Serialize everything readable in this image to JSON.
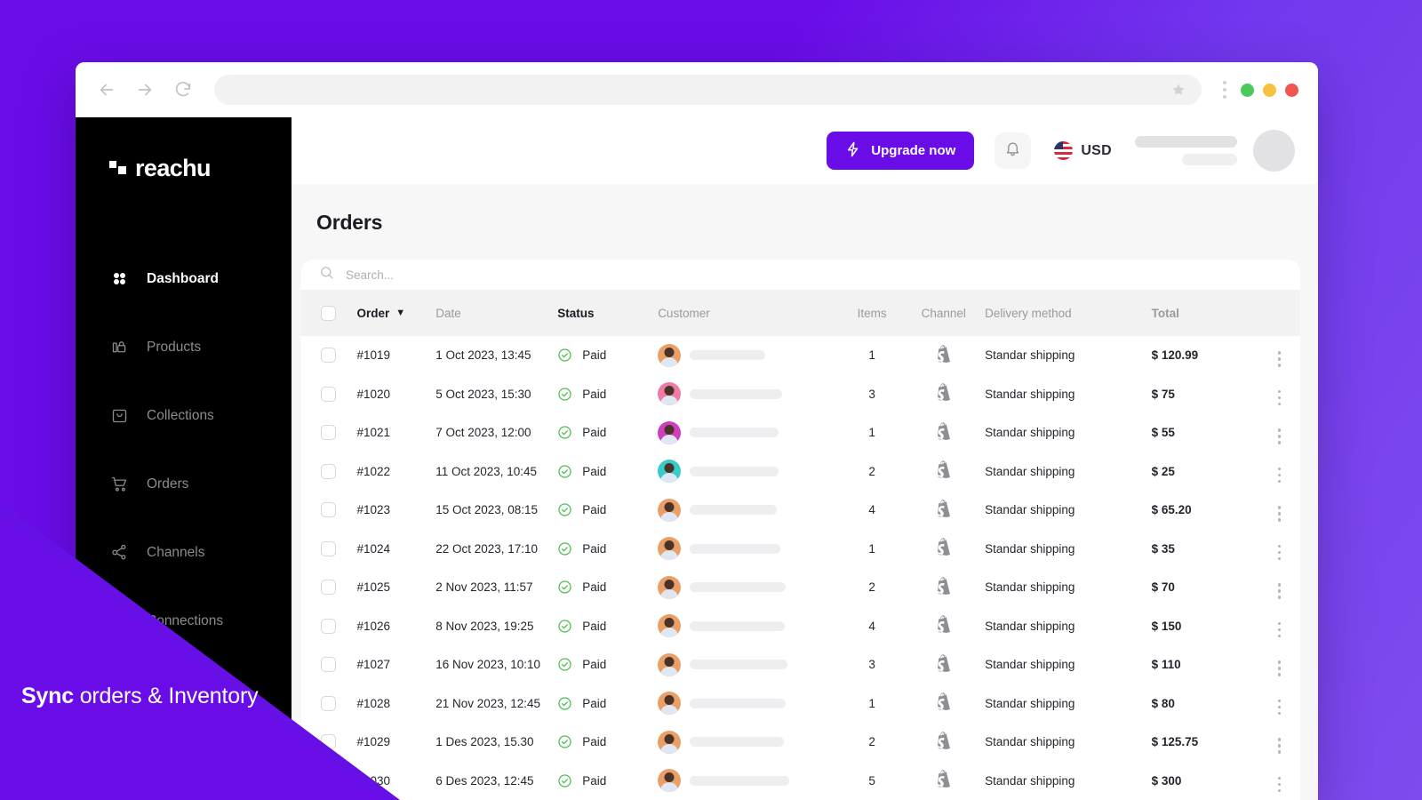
{
  "browser": {
    "back_icon": "arrow-left-icon",
    "forward_icon": "arrow-right-icon",
    "reload_icon": "reload-icon",
    "url_value": "",
    "url_placeholder": "",
    "bookmark_icon": "star-icon",
    "menu_icon": "kebab-menu-icon",
    "window_dots": [
      "#4CC95C",
      "#F7C13E",
      "#F0564F"
    ]
  },
  "sidebar": {
    "logo": "reachu",
    "items": [
      {
        "label": "Dashboard",
        "icon": "grid-icon",
        "active": true
      },
      {
        "label": "Products",
        "icon": "bag-icon",
        "active": false
      },
      {
        "label": "Collections",
        "icon": "collection-icon",
        "active": false
      },
      {
        "label": "Orders",
        "icon": "cart-icon",
        "active": false
      },
      {
        "label": "Channels",
        "icon": "share-nodes-icon",
        "active": false
      },
      {
        "label": "Connections",
        "icon": "users-icon",
        "active": false
      }
    ]
  },
  "topbar": {
    "upgrade_label": "Upgrade now",
    "upgrade_icon": "lightning-bolt-icon",
    "upgrade_color": "#6A0CE8",
    "notifications_icon": "bell-icon",
    "currency_flag": "us-flag-icon",
    "currency_label": "USD",
    "avatar": "user-avatar"
  },
  "page": {
    "title": "Orders",
    "search_placeholder": "Search..."
  },
  "table": {
    "columns": [
      {
        "key": "checkbox",
        "label": "",
        "strong": false
      },
      {
        "key": "order",
        "label": "Order",
        "strong": true,
        "sort": "▼"
      },
      {
        "key": "date",
        "label": "Date",
        "strong": false
      },
      {
        "key": "status",
        "label": "Status",
        "strong": true
      },
      {
        "key": "customer",
        "label": "Customer",
        "strong": false
      },
      {
        "key": "items",
        "label": "Items",
        "strong": false
      },
      {
        "key": "channel",
        "label": "Channel",
        "strong": false
      },
      {
        "key": "delivery",
        "label": "Delivery method",
        "strong": false
      },
      {
        "key": "total",
        "label": "Total",
        "strong": false
      }
    ],
    "status_icon": "check-circle-icon",
    "status_color": "#4DBE52",
    "channel_icon": "shopify-icon",
    "row_menu_icon": "kebab-menu-icon",
    "rows": [
      {
        "order": "#1019",
        "date": "1 Oct 2023, 13:45",
        "status": "Paid",
        "items": "1",
        "channel": "Shopify",
        "delivery": "Standar shipping",
        "total": "$ 120.99",
        "avatar_bg": "#E9A068",
        "name_w": 85
      },
      {
        "order": "#1020",
        "date": "5 Oct 2023, 15:30",
        "status": "Paid",
        "items": "3",
        "channel": "Shopify",
        "delivery": "Standar shipping",
        "total": "$ 75",
        "avatar_bg": "#EE7BA6",
        "name_w": 104
      },
      {
        "order": "#1021",
        "date": "7 Oct 2023, 12:00",
        "status": "Paid",
        "items": "1",
        "channel": "Shopify",
        "delivery": "Standar shipping",
        "total": "$ 55",
        "avatar_bg": "#CE3FC0",
        "name_w": 100
      },
      {
        "order": "#1022",
        "date": "11 Oct 2023, 10:45",
        "status": "Paid",
        "items": "2",
        "channel": "Shopify",
        "delivery": "Standar shipping",
        "total": "$ 25",
        "avatar_bg": "#38CBC9",
        "name_w": 100
      },
      {
        "order": "#1023",
        "date": "15 Oct 2023, 08:15",
        "status": "Paid",
        "items": "4",
        "channel": "Shopify",
        "delivery": "Standar shipping",
        "total": "$ 65.20",
        "avatar_bg": "#E9A068",
        "name_w": 98
      },
      {
        "order": "#1024",
        "date": "22 Oct 2023, 17:10",
        "status": "Paid",
        "items": "1",
        "channel": "Shopify",
        "delivery": "Standar shipping",
        "total": "$ 35",
        "avatar_bg": "#E9A068",
        "name_w": 102
      },
      {
        "order": "#1025",
        "date": "2 Nov 2023, 11:57",
        "status": "Paid",
        "items": "2",
        "channel": "Shopify",
        "delivery": "Standar shipping",
        "total": "$ 70",
        "avatar_bg": "#E9A068",
        "name_w": 108
      },
      {
        "order": "#1026",
        "date": "8 Nov 2023, 19:25",
        "status": "Paid",
        "items": "4",
        "channel": "Shopify",
        "delivery": "Standar shipping",
        "total": "$ 150",
        "avatar_bg": "#E9A068",
        "name_w": 107
      },
      {
        "order": "#1027",
        "date": "16 Nov 2023, 10:10",
        "status": "Paid",
        "items": "3",
        "channel": "Shopify",
        "delivery": "Standar shipping",
        "total": "$ 110",
        "avatar_bg": "#E9A068",
        "name_w": 110
      },
      {
        "order": "#1028",
        "date": "21 Nov 2023, 12:45",
        "status": "Paid",
        "items": "1",
        "channel": "Shopify",
        "delivery": "Standar shipping",
        "total": "$ 80",
        "avatar_bg": "#E9A068",
        "name_w": 108
      },
      {
        "order": "#1029",
        "date": "1 Des 2023, 15.30",
        "status": "Paid",
        "items": "2",
        "channel": "Shopify",
        "delivery": "Standar shipping",
        "total": "$ 125.75",
        "avatar_bg": "#E9A068",
        "name_w": 106
      },
      {
        "order": "#1030",
        "date": "6 Des 2023, 12:45",
        "status": "Paid",
        "items": "5",
        "channel": "Shopify",
        "delivery": "Standar shipping",
        "total": "$ 300",
        "avatar_bg": "#E9A068",
        "name_w": 112
      }
    ]
  },
  "overlay": {
    "tagline_bold": "Sync",
    "tagline_rest": " orders & Inventory",
    "bg_color": "#6A0CE8"
  }
}
